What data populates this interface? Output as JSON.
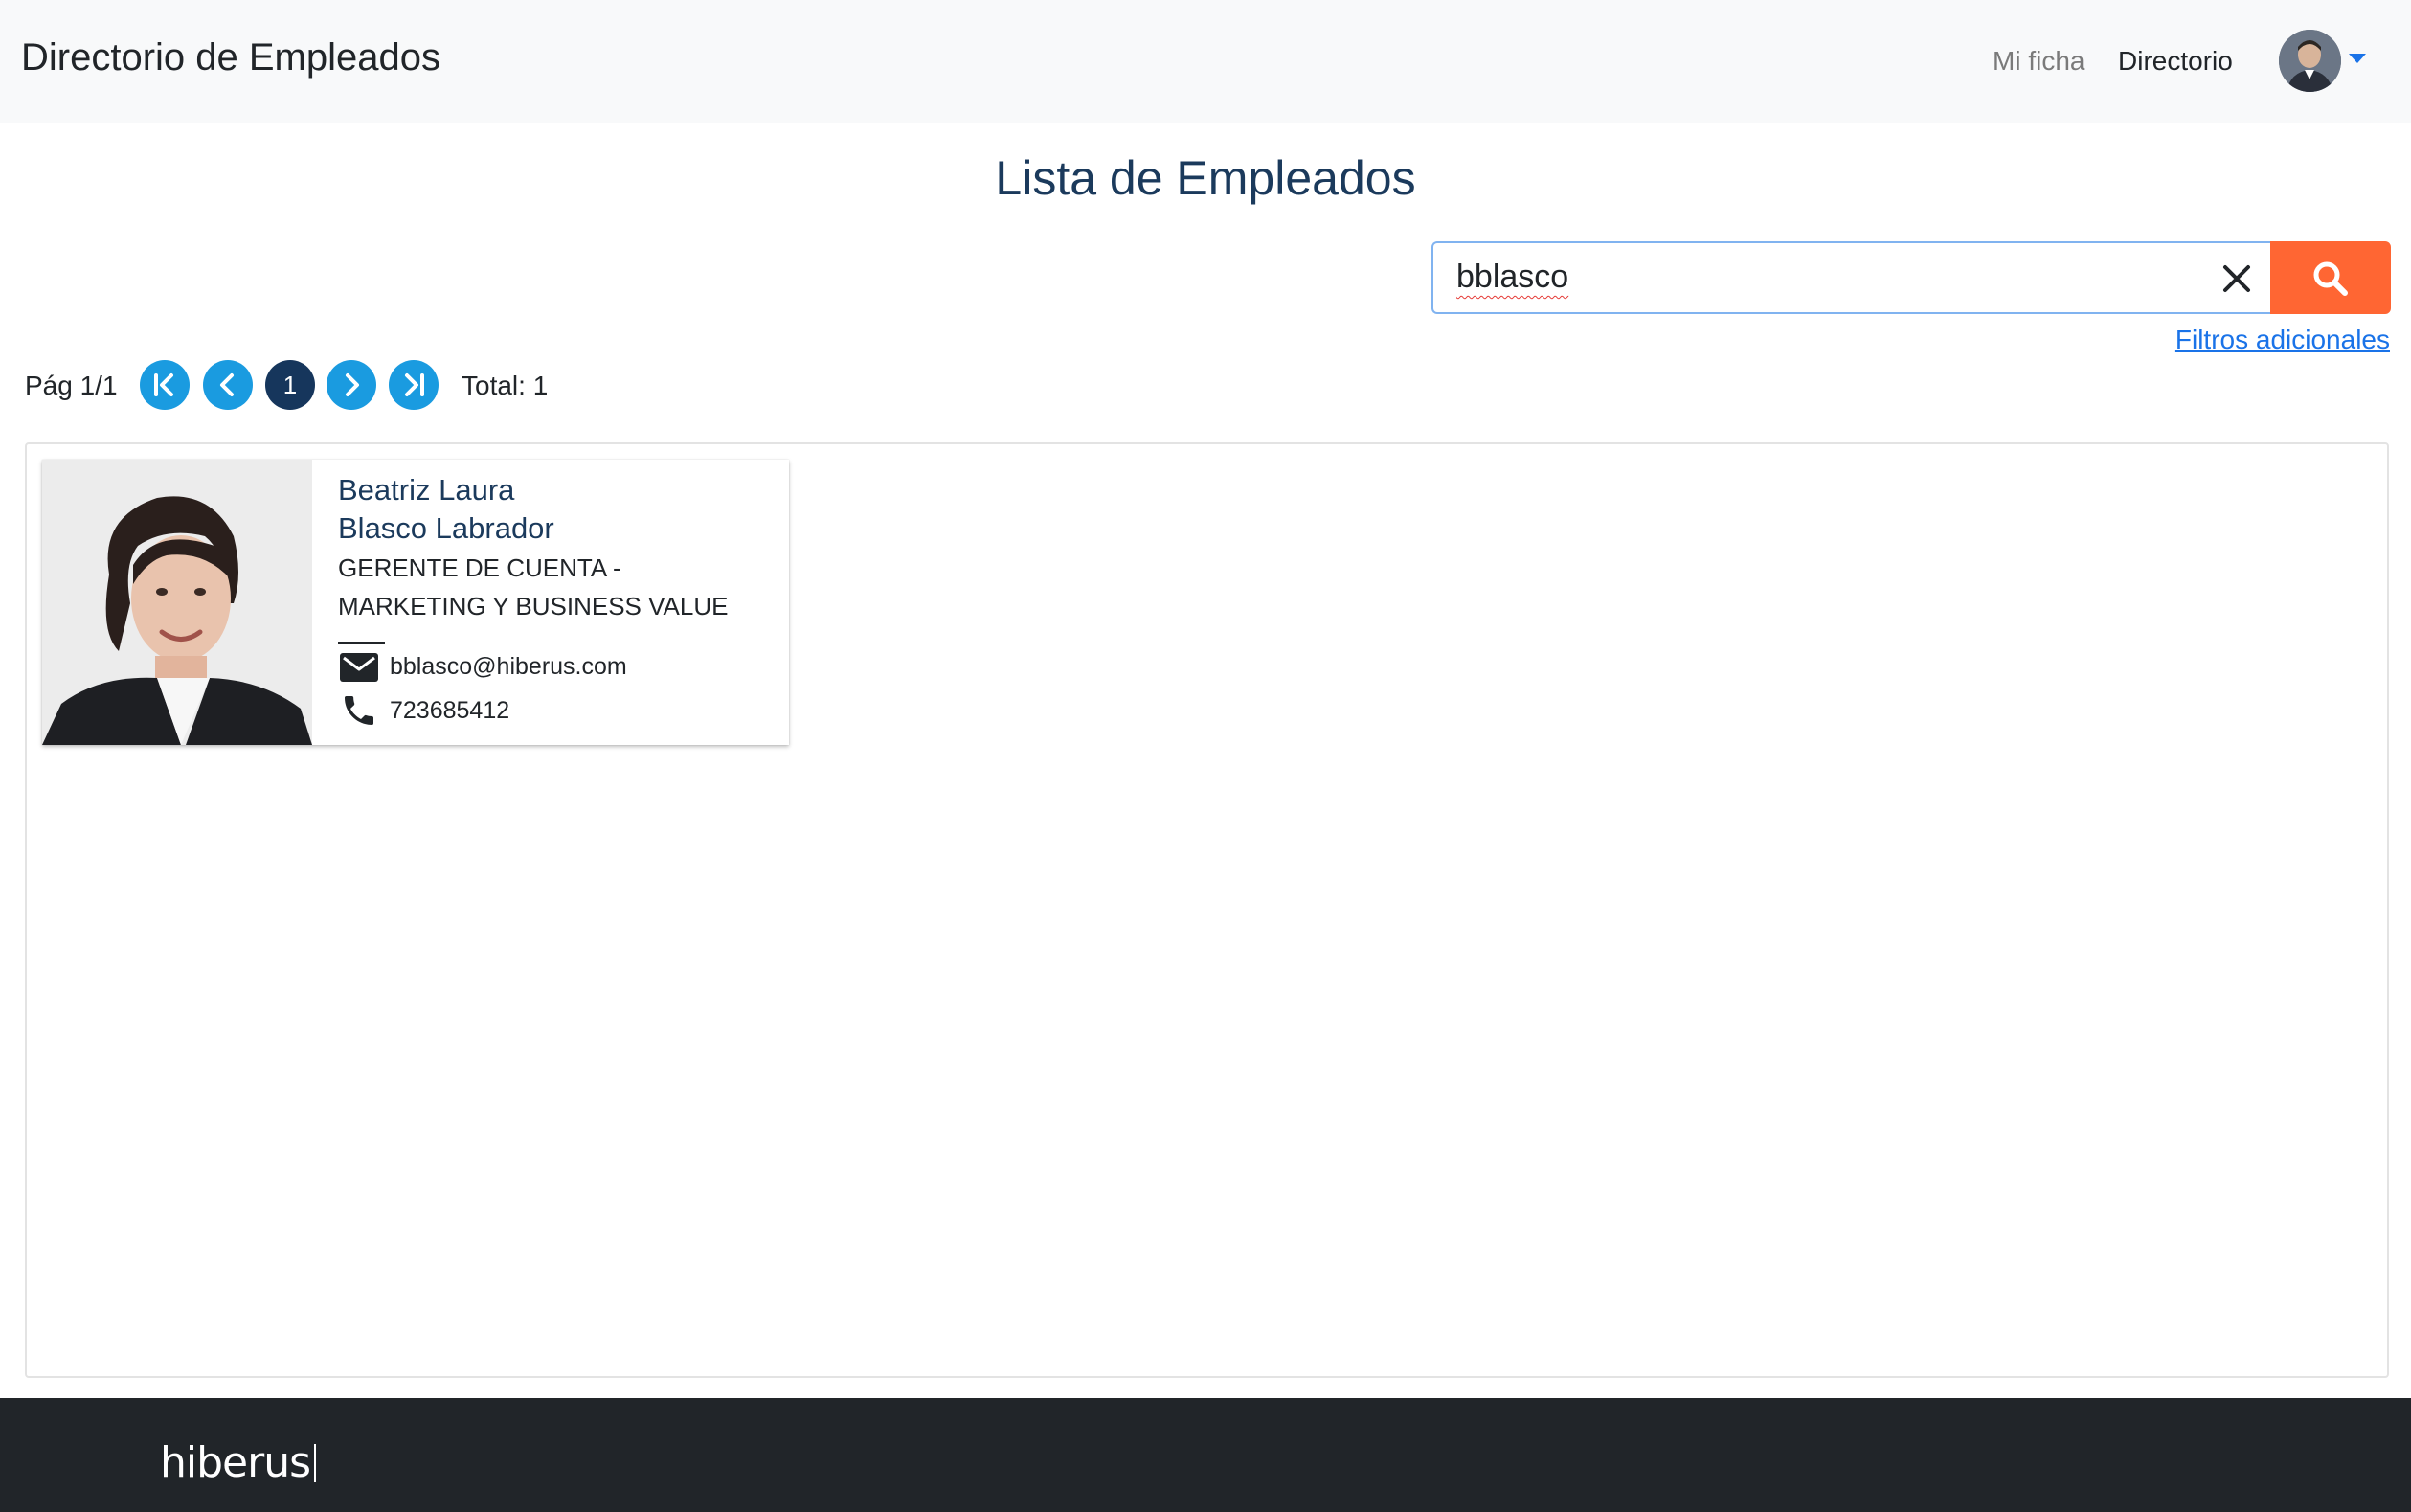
{
  "header": {
    "brand": "Directorio de Empleados",
    "nav": [
      {
        "label": "Mi ficha"
      },
      {
        "label": "Directorio"
      }
    ],
    "user_menu_icon": "caret-down-icon"
  },
  "main": {
    "title": "Lista de Empleados",
    "search": {
      "value": "bblasco",
      "clear_icon": "close-icon",
      "search_icon": "search-icon"
    },
    "additional_filters_label": "Filtros adicionales",
    "pagination": {
      "page_label": "Pág 1/1",
      "current_page": "1",
      "total_label": "Total: 1"
    },
    "employees": [
      {
        "first_name": "Beatriz Laura",
        "last_name": "Blasco Labrador",
        "role_line1": "GERENTE DE CUENTA -",
        "role_line2": "MARKETING Y BUSINESS VALUE",
        "email": "bblasco@hiberus.com",
        "phone": "723685412"
      }
    ]
  },
  "footer": {
    "logo": "hiberus"
  },
  "colors": {
    "accent_orange": "#ff6633",
    "pagination_blue": "#1a9be0",
    "pagination_current": "#16365c",
    "title_navy": "#1b3a5c",
    "link_blue": "#1a73e8",
    "footer_bg": "#212529"
  }
}
